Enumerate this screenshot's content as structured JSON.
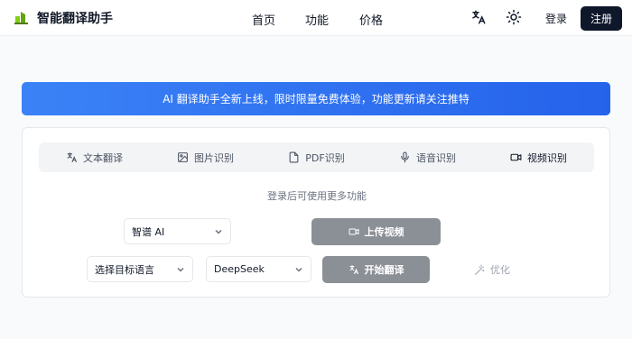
{
  "header": {
    "brand": "智能翻译助手",
    "nav": [
      "首页",
      "功能",
      "价格"
    ],
    "login": "登录",
    "signup": "注册"
  },
  "banner": {
    "text": "AI 翻译助手全新上线，限时限量免费体验，功能更新请关注推特"
  },
  "tabs": [
    {
      "label": "文本翻译",
      "icon": "translate-icon"
    },
    {
      "label": "图片识别",
      "icon": "image-icon"
    },
    {
      "label": "PDF识别",
      "icon": "file-icon"
    },
    {
      "label": "语音识别",
      "icon": "mic-icon"
    },
    {
      "label": "视频识别",
      "icon": "video-icon",
      "active": true
    }
  ],
  "main": {
    "hint": "登录后可使用更多功能",
    "model_select": "智谱 AI",
    "upload_button": "上传视频",
    "language_select": "选择目标语言",
    "engine_select": "DeepSeek",
    "start_button": "开始翻译",
    "optimize": "优化"
  },
  "colors": {
    "banner": "#3b82f6",
    "signup_bg": "#0f172a",
    "button_gray": "#8b8f96"
  }
}
